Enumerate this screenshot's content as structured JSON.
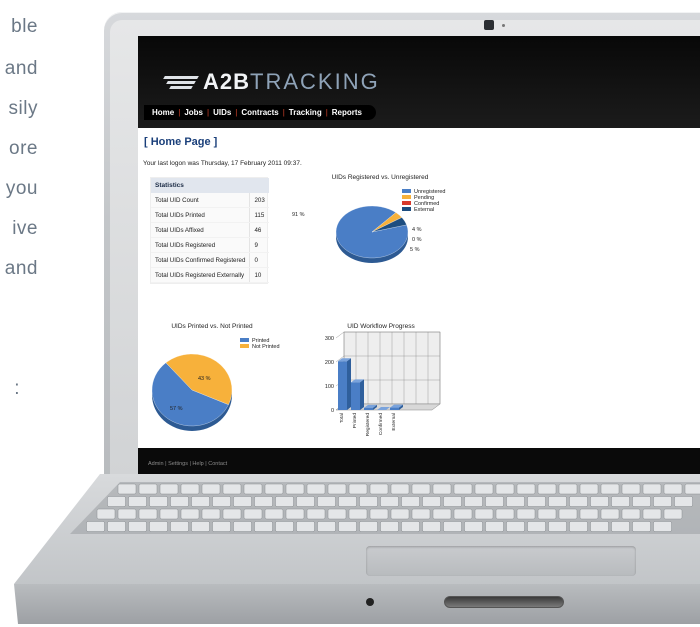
{
  "side_text": [
    "ble",
    "and",
    "sily",
    "ore",
    "you",
    "ive",
    "and",
    ":"
  ],
  "app": {
    "logo_strong": "A2B",
    "logo_thin": "TRACKING",
    "nav": [
      "Home",
      "Jobs",
      "UIDs",
      "Contracts",
      "Tracking",
      "Reports"
    ],
    "page_title": "[ Home Page ]",
    "last_logon": "Your last logon was Thursday, 17 February 2011 09:37.",
    "footer_links": "Admin  |  Settings  |  Help  |  Contact"
  },
  "statistics": {
    "header": "Statistics",
    "rows": [
      {
        "label": "Total UID Count",
        "value": "203"
      },
      {
        "label": "Total UIDs Printed",
        "value": "115"
      },
      {
        "label": "Total UIDs Affixed",
        "value": "46"
      },
      {
        "label": "Total UIDs Registered",
        "value": "9"
      },
      {
        "label": "Total UIDs Confirmed Registered",
        "value": "0"
      },
      {
        "label": "Total UIDs Registered Externally",
        "value": "10"
      }
    ]
  },
  "colors": {
    "blue": "#4a7ec6",
    "orange": "#f7b13b",
    "red": "#d83a2c",
    "navy": "#1d4d80"
  },
  "chart_data": [
    {
      "type": "pie",
      "title": "UIDs Registered vs. Unregistered",
      "categories": [
        "Unregistered",
        "Pending",
        "Confirmed",
        "External"
      ],
      "values": [
        91,
        4,
        0,
        5
      ],
      "labels": [
        "91 %",
        "4 %",
        "0 %",
        "5 %"
      ]
    },
    {
      "type": "pie",
      "title": "UIDs Printed vs. Not Printed",
      "categories": [
        "Printed",
        "Not Printed"
      ],
      "values": [
        57,
        43
      ],
      "labels": [
        "57 %",
        "43 %"
      ]
    },
    {
      "type": "bar",
      "title": "UID Workflow Progress",
      "categories": [
        "Total",
        "Printed",
        "Registered",
        "Confirmed",
        "External"
      ],
      "values": [
        203,
        115,
        9,
        0,
        10
      ],
      "ylim": [
        0,
        300
      ],
      "yticks": [
        "0",
        "100",
        "200",
        "300"
      ]
    }
  ]
}
